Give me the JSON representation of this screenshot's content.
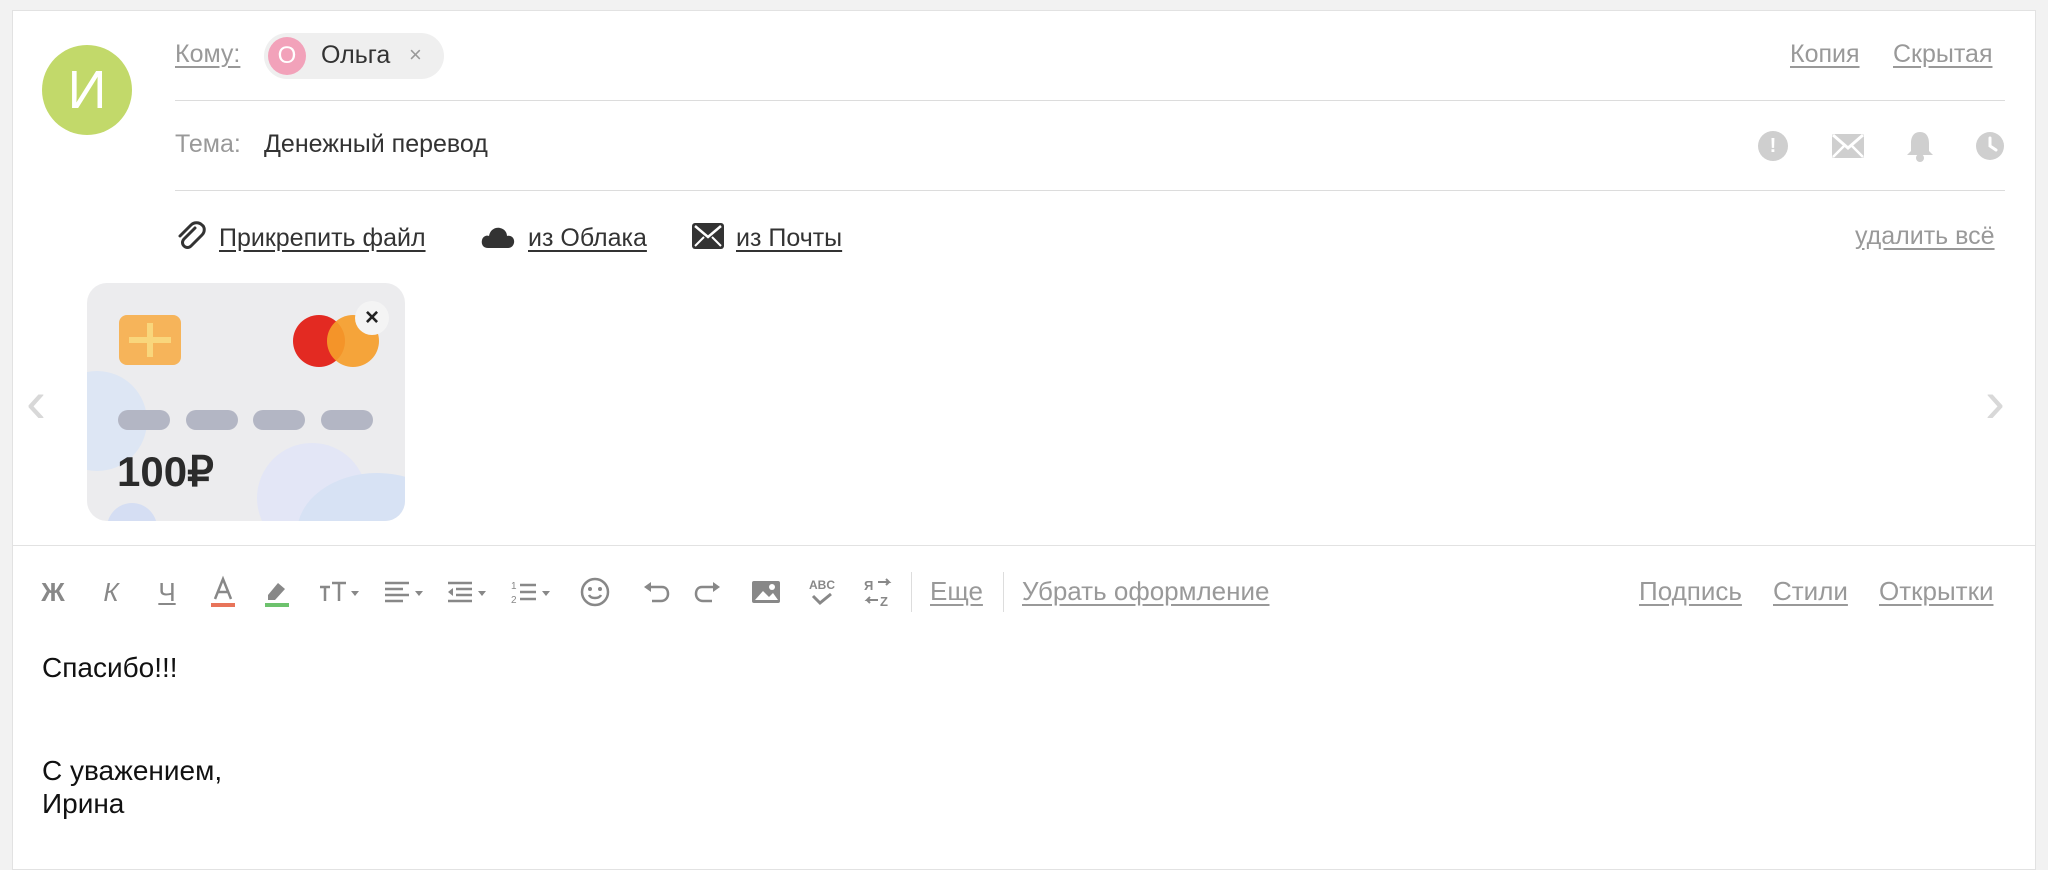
{
  "sender": {
    "avatar_letter": "И",
    "avatar_color": "#c2d96a"
  },
  "to": {
    "label": "Кому:",
    "recipient": {
      "initial": "О",
      "name": "Ольга",
      "remove": "×",
      "avatar_color": "#f2a2ba"
    },
    "cc_label": "Копия",
    "bcc_label": "Скрытая"
  },
  "subject": {
    "label": "Тема:",
    "value": "Денежный перевод",
    "icons": [
      "important-icon",
      "notify-read-icon",
      "reminder-bell-icon",
      "schedule-clock-icon"
    ]
  },
  "attachments": {
    "attach_file": "Прикрепить файл",
    "from_cloud": "из Облака",
    "from_mail": "из Почты",
    "delete_all": "удалить всё"
  },
  "money_card": {
    "amount": "100₽",
    "remove": "×"
  },
  "nav": {
    "prev": "‹",
    "next": "›"
  },
  "toolbar": {
    "bold": "Ж",
    "italic": "К",
    "underline": "Ч",
    "more": "Еще",
    "clear_formatting": "Убрать оформление",
    "signature": "Подпись",
    "styles": "Стили",
    "postcards": "Открытки",
    "spellcheck_abc": "ABC"
  },
  "body": {
    "line1": "Спасибо!!!",
    "line2": "С уважением,",
    "line3": "Ирина"
  }
}
